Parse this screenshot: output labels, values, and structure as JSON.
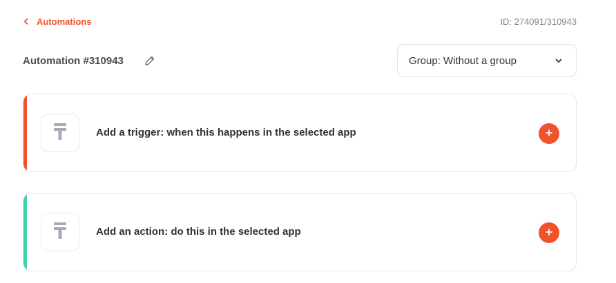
{
  "header": {
    "back_label": "Automations",
    "id_label": "ID: 274091/310943"
  },
  "automation": {
    "title": "Automation #310943"
  },
  "group_select": {
    "value": "Group: Without a group"
  },
  "steps": [
    {
      "kind": "trigger",
      "label": "Add a trigger: when this happens in the selected app",
      "accent_color": "#f0522b"
    },
    {
      "kind": "action",
      "label": "Add an action: do this in the selected app",
      "accent_color": "#3fd3b0"
    }
  ],
  "icons": {
    "back": "chevron-left-icon",
    "edit": "pencil-icon",
    "dropdown": "chevron-down-icon",
    "app_placeholder": "app-placeholder-icon",
    "add": "plus-icon"
  },
  "colors": {
    "brand": "#f0522b",
    "trigger_accent": "#f0522b",
    "action_accent": "#3fd3b0",
    "placeholder_icon": "#a6abb6"
  }
}
